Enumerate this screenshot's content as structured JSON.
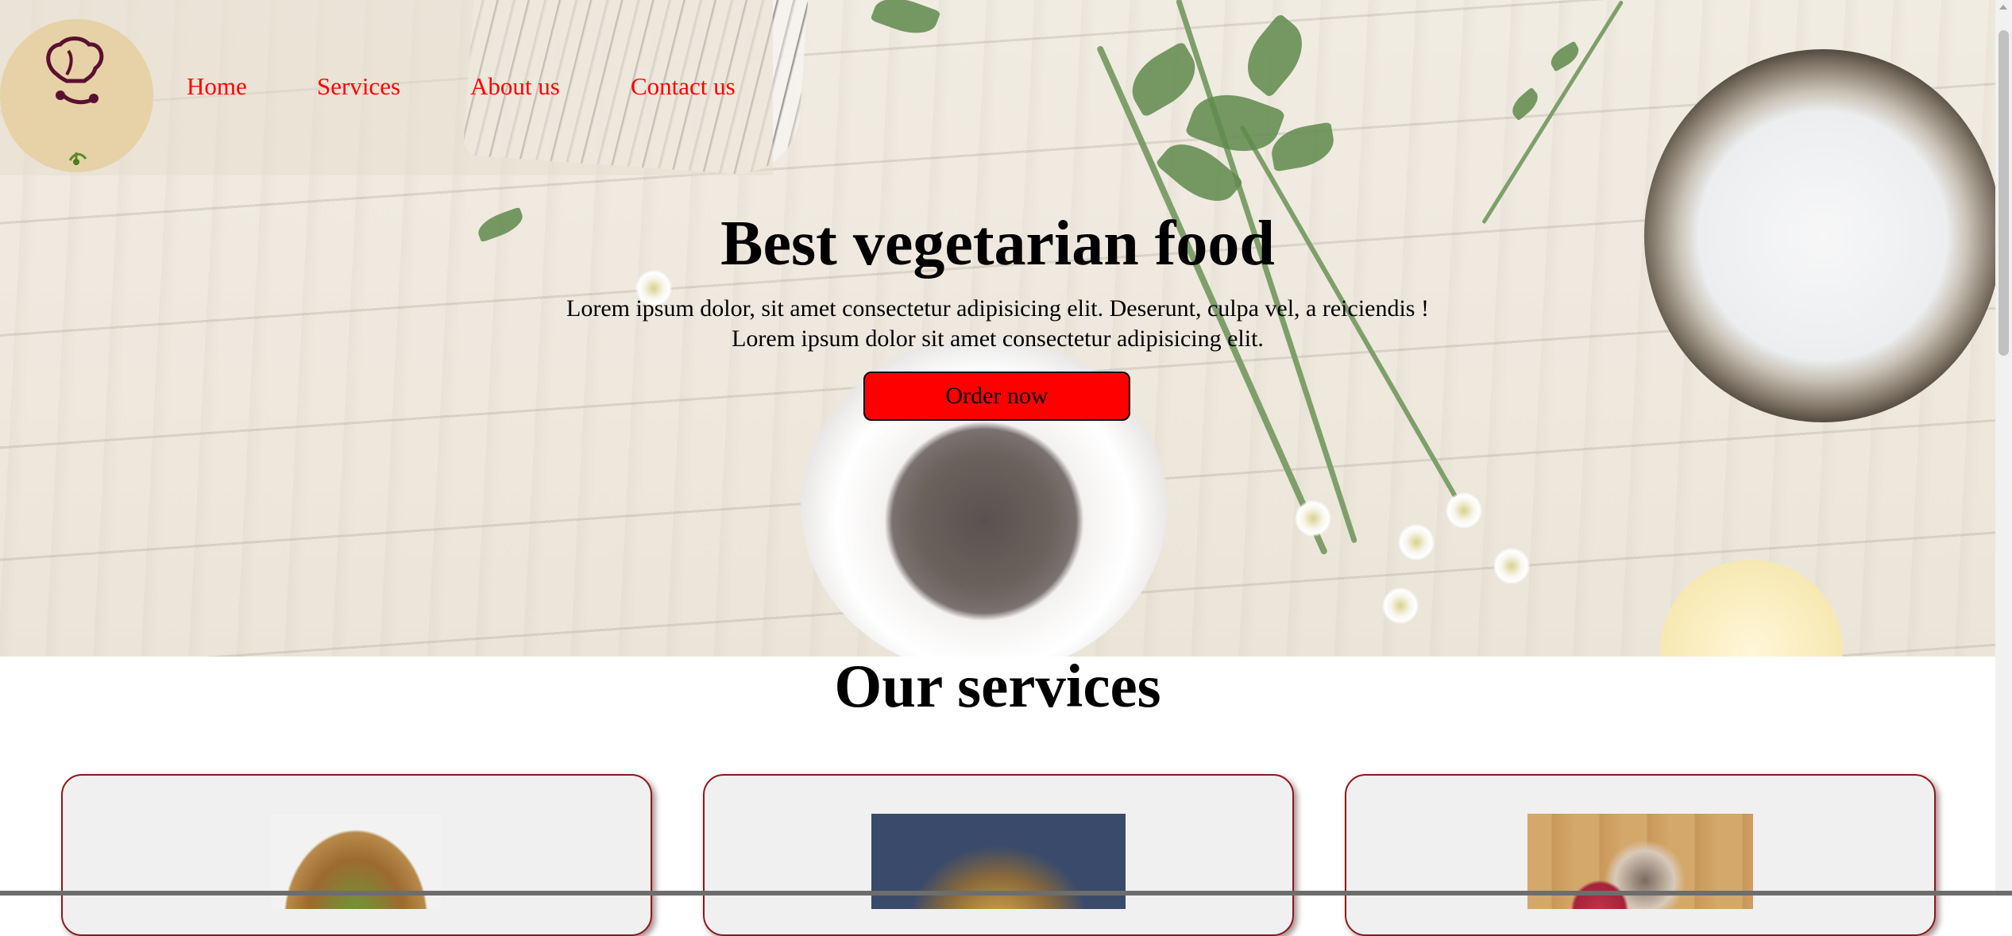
{
  "header": {
    "logo_icon": "chef-hat-logo-icon",
    "nav": [
      {
        "label": "Home"
      },
      {
        "label": "Services"
      },
      {
        "label": "About us"
      },
      {
        "label": "Contact us"
      }
    ],
    "link_color": "#ff0000"
  },
  "hero": {
    "title": "Best vegetarian food",
    "text_line1": "Lorem ipsum dolor, sit amet consectetur adipisicing elit. Deserunt, culpa vel, a reiciendis !",
    "text_line2": "Lorem ipsum dolor sit amet consectetur adipisicing elit.",
    "button_label": "Order now",
    "button_color": "#ff0000"
  },
  "services": {
    "title": "Our services",
    "cards": [
      {
        "image": "salad-bowl-image"
      },
      {
        "image": "food-platter-image"
      },
      {
        "image": "grocery-bag-image"
      }
    ],
    "card_border_color": "#8b1a1a"
  }
}
